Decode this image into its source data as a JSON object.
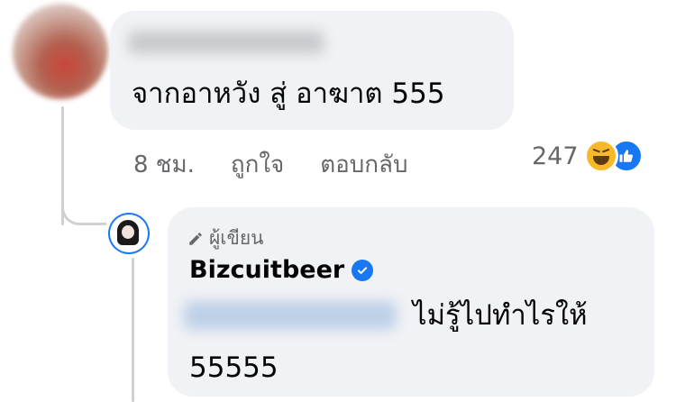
{
  "comment": {
    "text": "จากอาหวัง สู่ อาฆาต 555",
    "time": "8 ชม.",
    "like_label": "ถูกใจ",
    "reply_label": "ตอบกลับ",
    "reaction_count": "247",
    "reaction_icons": [
      "haha-icon",
      "like-icon"
    ]
  },
  "reply": {
    "author_badge": "ผู้เขียน",
    "author_name": "Bizcuitbeer",
    "text_line1": "ไม่รู้ไปทำไรให้",
    "text_line2": "55555"
  },
  "colors": {
    "bubble": "#f0f2f5",
    "secondary_text": "#65676b",
    "accent": "#1877f2",
    "haha": "#f7b928"
  }
}
